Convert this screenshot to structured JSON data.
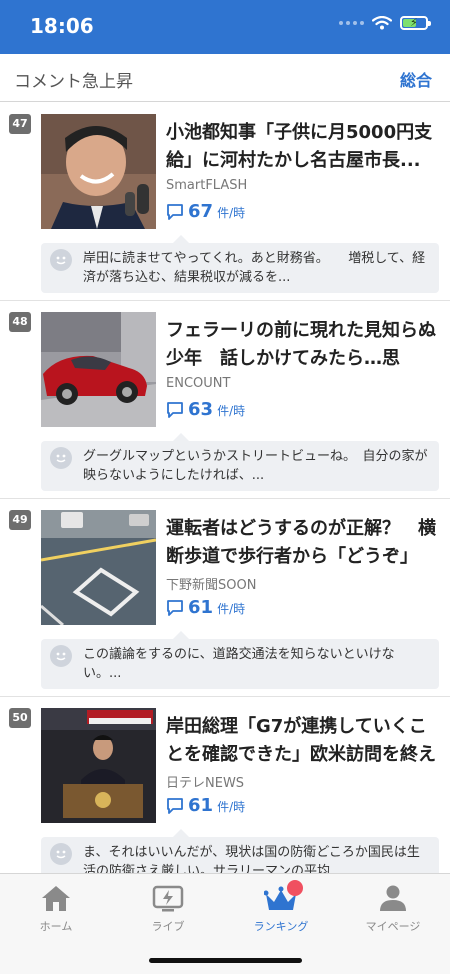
{
  "status": {
    "time": "18:06"
  },
  "header": {
    "title": "コメント急上昇",
    "link": "総合"
  },
  "articles": [
    {
      "rank": "47",
      "title": "小池都知事「子供に月5000円支給」に河村たかし名古屋市長...",
      "source": "SmartFLASH",
      "count": "67",
      "unit": "件/時",
      "comment": "岸田に読ませてやってくれ。あと財務省。　　増税して、経済が落ち込む、結果税収が減るを..."
    },
    {
      "rank": "48",
      "title": "フェラーリの前に現れた見知らぬ少年　話しかけてみたら…思わ...",
      "source": "ENCOUNT",
      "count": "63",
      "unit": "件/時",
      "comment": "グーグルマップというかストリートビューね。　自分の家が映らないようにしたければ、..."
    },
    {
      "rank": "49",
      "title": "運転者はどうするのが正解？　横断歩道で歩行者から「どうぞ」",
      "source": "下野新聞SOON",
      "count": "61",
      "unit": "件/時",
      "comment": "この議論をするのに、道路交通法を知らないといけない。..."
    },
    {
      "rank": "50",
      "title": "岸田総理「G7が連携していくことを確認できた」欧米訪問を終え",
      "source": "日テレNEWS",
      "count": "61",
      "unit": "件/時",
      "comment": "ま、それはいいんだが、現状は国の防衛どころか国民は生活の防衛さえ厳しい。サラリーマンの平均..."
    }
  ],
  "tabs": [
    {
      "label": "ホーム",
      "icon": "home-icon"
    },
    {
      "label": "ライブ",
      "icon": "live-icon"
    },
    {
      "label": "ランキング",
      "icon": "ranking-crown-icon"
    },
    {
      "label": "マイページ",
      "icon": "user-icon"
    }
  ],
  "colors": {
    "accent": "#2f74d0",
    "badge": "#f05060",
    "comment_bg": "#eef0f3"
  }
}
